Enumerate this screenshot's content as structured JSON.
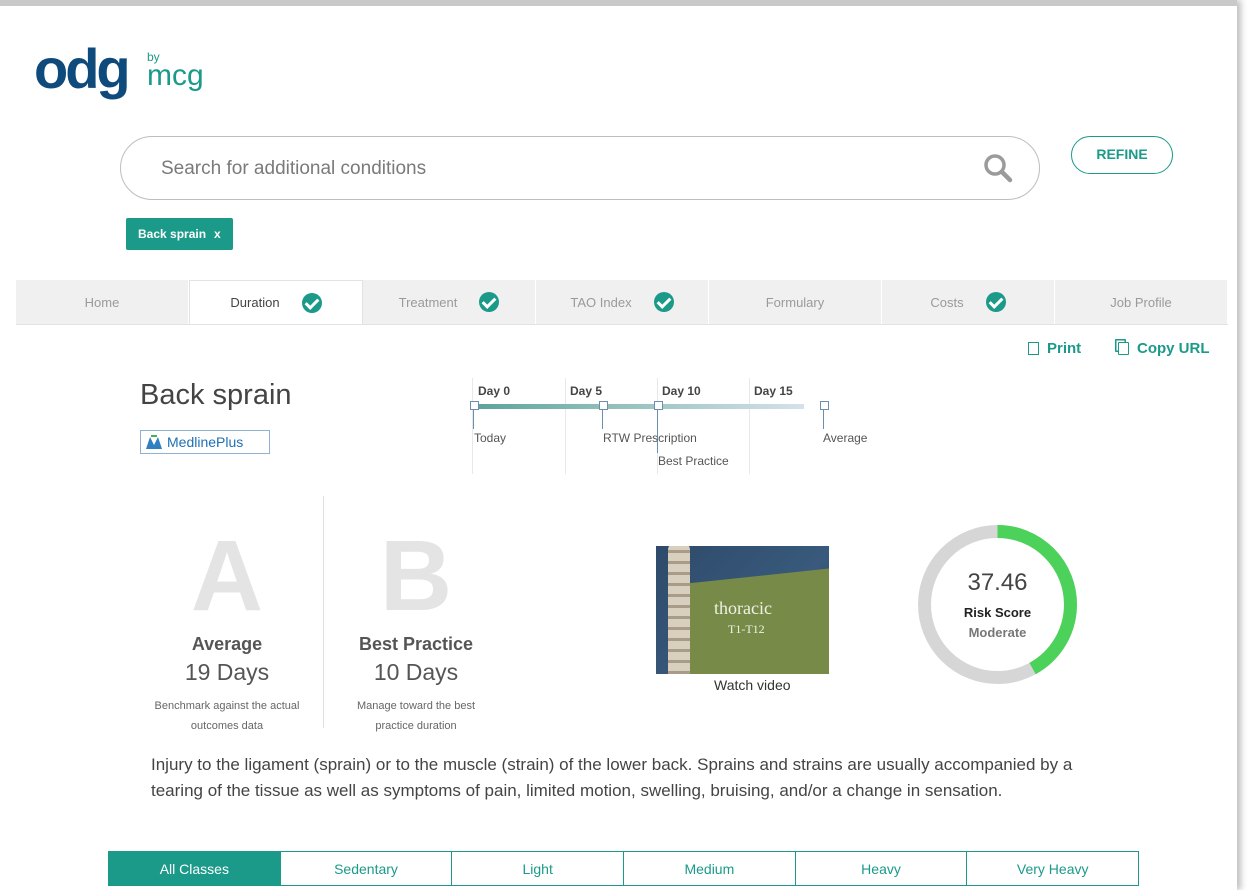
{
  "brand": {
    "odg": "odg",
    "by": "by",
    "mcg": "mcg"
  },
  "search": {
    "placeholder": "Search for additional conditions"
  },
  "refine_label": "REFINE",
  "chips": [
    {
      "label": "Back sprain",
      "remove": "x"
    }
  ],
  "tabs": [
    {
      "label": "Home",
      "checked": false
    },
    {
      "label": "Duration",
      "checked": true,
      "active": true
    },
    {
      "label": "Treatment",
      "checked": true
    },
    {
      "label": "TAO Index",
      "checked": true
    },
    {
      "label": "Formulary",
      "checked": false
    },
    {
      "label": "Costs",
      "checked": true
    },
    {
      "label": "Job Profile",
      "checked": false
    }
  ],
  "actions": {
    "print": "Print",
    "copy_url": "Copy URL"
  },
  "condition": {
    "title": "Back sprain",
    "source_badge": "MedlinePlus"
  },
  "timeline": {
    "days": [
      "Day 0",
      "Day 5",
      "Day 10",
      "Day 15"
    ],
    "markers": {
      "today": "Today",
      "rtw": "RTW Prescription",
      "best": "Best Practice",
      "average": "Average"
    }
  },
  "metrics": {
    "a": {
      "letter": "A",
      "name": "Average",
      "days": "19 Days",
      "desc_line1": "Benchmark against the actual",
      "desc_line2": "outcomes data"
    },
    "b": {
      "letter": "B",
      "name": "Best Practice",
      "days": "10 Days",
      "desc_line1": "Manage toward the best",
      "desc_line2": "practice duration"
    }
  },
  "video": {
    "title": "thoracic",
    "subtitle": "T1-T12",
    "caption": "Watch video"
  },
  "risk": {
    "score": "37.46",
    "label": "Risk Score",
    "level": "Moderate",
    "fraction": 0.42,
    "color": "#4cd15a",
    "track_color": "#d6d6d6"
  },
  "description": "Injury to the ligament (sprain) or to the muscle (strain) of the lower back. Sprains and strains are usually accompanied by a tearing of the tissue as well as symptoms of pain, limited motion, swelling, bruising, and/or a change in sensation.",
  "job_classes": [
    "All Classes",
    "Sedentary",
    "Light",
    "Medium",
    "Heavy",
    "Very Heavy"
  ],
  "colors": {
    "accent": "#1b9a8a",
    "brand_blue": "#0f4a7c"
  }
}
